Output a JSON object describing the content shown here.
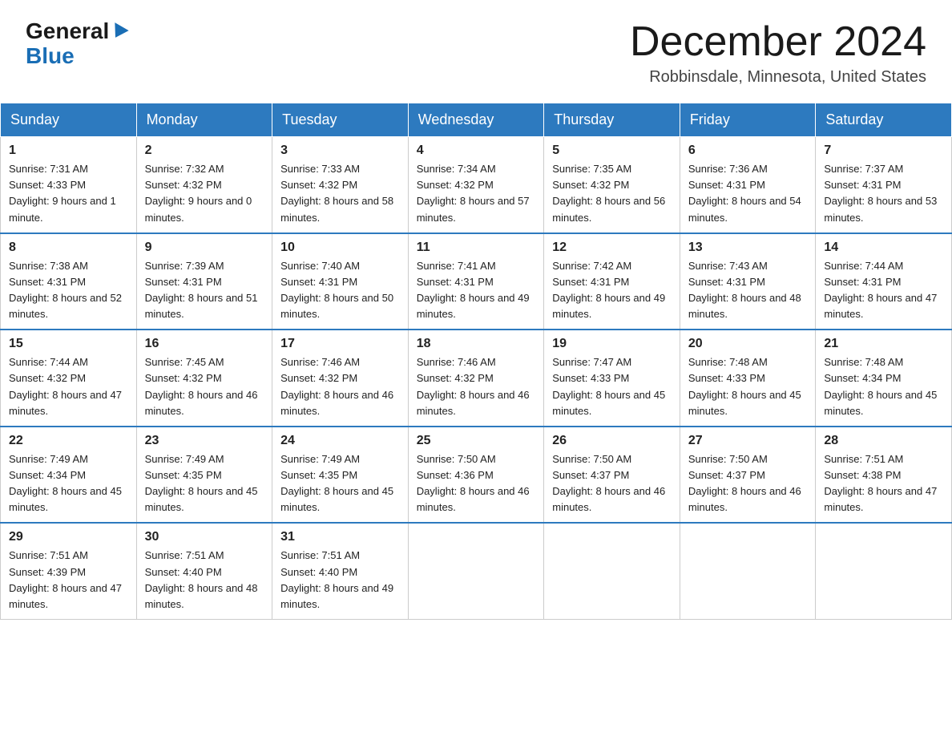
{
  "header": {
    "logo_general": "General",
    "logo_blue": "Blue",
    "month_title": "December 2024",
    "location": "Robbinsdale, Minnesota, United States"
  },
  "days_of_week": [
    "Sunday",
    "Monday",
    "Tuesday",
    "Wednesday",
    "Thursday",
    "Friday",
    "Saturday"
  ],
  "weeks": [
    [
      {
        "day": "1",
        "sunrise": "7:31 AM",
        "sunset": "4:33 PM",
        "daylight": "9 hours and 1 minute."
      },
      {
        "day": "2",
        "sunrise": "7:32 AM",
        "sunset": "4:32 PM",
        "daylight": "9 hours and 0 minutes."
      },
      {
        "day": "3",
        "sunrise": "7:33 AM",
        "sunset": "4:32 PM",
        "daylight": "8 hours and 58 minutes."
      },
      {
        "day": "4",
        "sunrise": "7:34 AM",
        "sunset": "4:32 PM",
        "daylight": "8 hours and 57 minutes."
      },
      {
        "day": "5",
        "sunrise": "7:35 AM",
        "sunset": "4:32 PM",
        "daylight": "8 hours and 56 minutes."
      },
      {
        "day": "6",
        "sunrise": "7:36 AM",
        "sunset": "4:31 PM",
        "daylight": "8 hours and 54 minutes."
      },
      {
        "day": "7",
        "sunrise": "7:37 AM",
        "sunset": "4:31 PM",
        "daylight": "8 hours and 53 minutes."
      }
    ],
    [
      {
        "day": "8",
        "sunrise": "7:38 AM",
        "sunset": "4:31 PM",
        "daylight": "8 hours and 52 minutes."
      },
      {
        "day": "9",
        "sunrise": "7:39 AM",
        "sunset": "4:31 PM",
        "daylight": "8 hours and 51 minutes."
      },
      {
        "day": "10",
        "sunrise": "7:40 AM",
        "sunset": "4:31 PM",
        "daylight": "8 hours and 50 minutes."
      },
      {
        "day": "11",
        "sunrise": "7:41 AM",
        "sunset": "4:31 PM",
        "daylight": "8 hours and 49 minutes."
      },
      {
        "day": "12",
        "sunrise": "7:42 AM",
        "sunset": "4:31 PM",
        "daylight": "8 hours and 49 minutes."
      },
      {
        "day": "13",
        "sunrise": "7:43 AM",
        "sunset": "4:31 PM",
        "daylight": "8 hours and 48 minutes."
      },
      {
        "day": "14",
        "sunrise": "7:44 AM",
        "sunset": "4:31 PM",
        "daylight": "8 hours and 47 minutes."
      }
    ],
    [
      {
        "day": "15",
        "sunrise": "7:44 AM",
        "sunset": "4:32 PM",
        "daylight": "8 hours and 47 minutes."
      },
      {
        "day": "16",
        "sunrise": "7:45 AM",
        "sunset": "4:32 PM",
        "daylight": "8 hours and 46 minutes."
      },
      {
        "day": "17",
        "sunrise": "7:46 AM",
        "sunset": "4:32 PM",
        "daylight": "8 hours and 46 minutes."
      },
      {
        "day": "18",
        "sunrise": "7:46 AM",
        "sunset": "4:32 PM",
        "daylight": "8 hours and 46 minutes."
      },
      {
        "day": "19",
        "sunrise": "7:47 AM",
        "sunset": "4:33 PM",
        "daylight": "8 hours and 45 minutes."
      },
      {
        "day": "20",
        "sunrise": "7:48 AM",
        "sunset": "4:33 PM",
        "daylight": "8 hours and 45 minutes."
      },
      {
        "day": "21",
        "sunrise": "7:48 AM",
        "sunset": "4:34 PM",
        "daylight": "8 hours and 45 minutes."
      }
    ],
    [
      {
        "day": "22",
        "sunrise": "7:49 AM",
        "sunset": "4:34 PM",
        "daylight": "8 hours and 45 minutes."
      },
      {
        "day": "23",
        "sunrise": "7:49 AM",
        "sunset": "4:35 PM",
        "daylight": "8 hours and 45 minutes."
      },
      {
        "day": "24",
        "sunrise": "7:49 AM",
        "sunset": "4:35 PM",
        "daylight": "8 hours and 45 minutes."
      },
      {
        "day": "25",
        "sunrise": "7:50 AM",
        "sunset": "4:36 PM",
        "daylight": "8 hours and 46 minutes."
      },
      {
        "day": "26",
        "sunrise": "7:50 AM",
        "sunset": "4:37 PM",
        "daylight": "8 hours and 46 minutes."
      },
      {
        "day": "27",
        "sunrise": "7:50 AM",
        "sunset": "4:37 PM",
        "daylight": "8 hours and 46 minutes."
      },
      {
        "day": "28",
        "sunrise": "7:51 AM",
        "sunset": "4:38 PM",
        "daylight": "8 hours and 47 minutes."
      }
    ],
    [
      {
        "day": "29",
        "sunrise": "7:51 AM",
        "sunset": "4:39 PM",
        "daylight": "8 hours and 47 minutes."
      },
      {
        "day": "30",
        "sunrise": "7:51 AM",
        "sunset": "4:40 PM",
        "daylight": "8 hours and 48 minutes."
      },
      {
        "day": "31",
        "sunrise": "7:51 AM",
        "sunset": "4:40 PM",
        "daylight": "8 hours and 49 minutes."
      },
      null,
      null,
      null,
      null
    ]
  ]
}
